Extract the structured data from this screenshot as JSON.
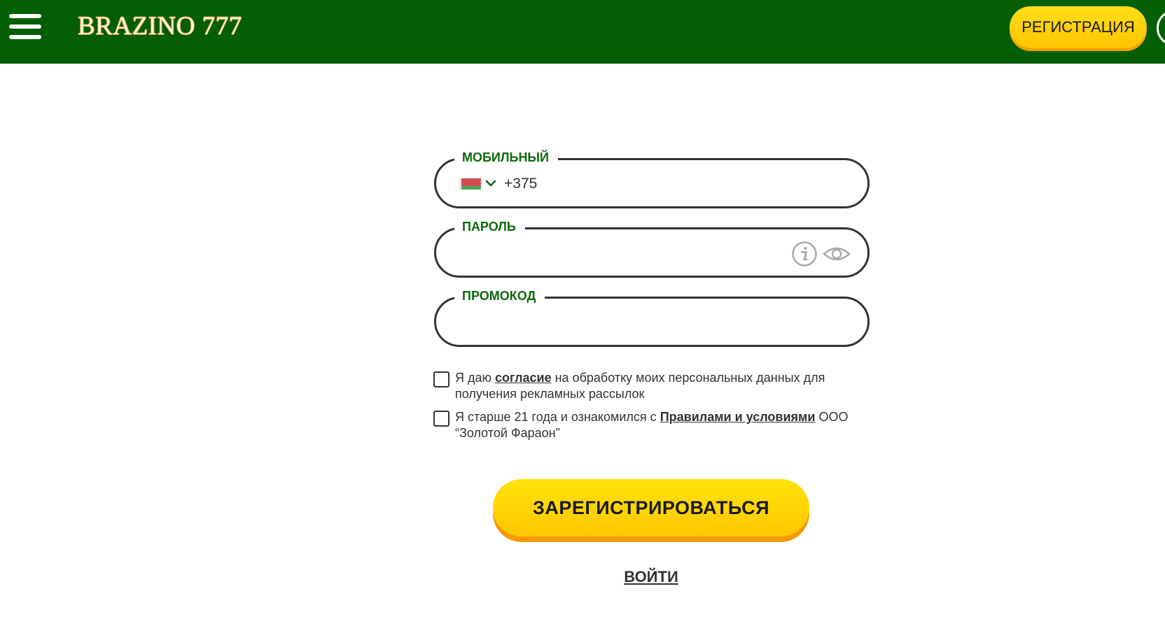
{
  "header": {
    "logo_text": "BRAZINO 777",
    "register_label": "РЕГИСТРАЦИЯ",
    "menu_icon": "hamburger-icon",
    "background_color": "#035e04"
  },
  "form": {
    "mobile": {
      "label": "МОБИЛЬНЫЙ",
      "country_flag": "belarus-flag-icon",
      "country_code": "+375",
      "value": ""
    },
    "password": {
      "label": "ПАРОЛЬ",
      "value": "",
      "info_icon": "info-icon",
      "visibility_icon": "eye-icon"
    },
    "promo": {
      "label": "ПРОМОКОД",
      "value": ""
    },
    "consent": {
      "checked": false,
      "prefix": "Я даю ",
      "link": "согласие",
      "suffix": " на обработку моих персональных данных для получения рекламных рассылок"
    },
    "age": {
      "checked": false,
      "prefix": "Я старше 21 года и ознакомился с ",
      "link": "Правилами и условиями",
      "suffix": " ООО “Золотой Фараон”"
    },
    "submit_label": "ЗАРЕГИСТРИРОВАТЬСЯ",
    "login_label": "ВОЙТИ"
  },
  "colors": {
    "brand_green": "#035e04",
    "label_green": "#0b6a0b",
    "button_yellow": "#ffd200",
    "button_shadow": "#f79800"
  }
}
